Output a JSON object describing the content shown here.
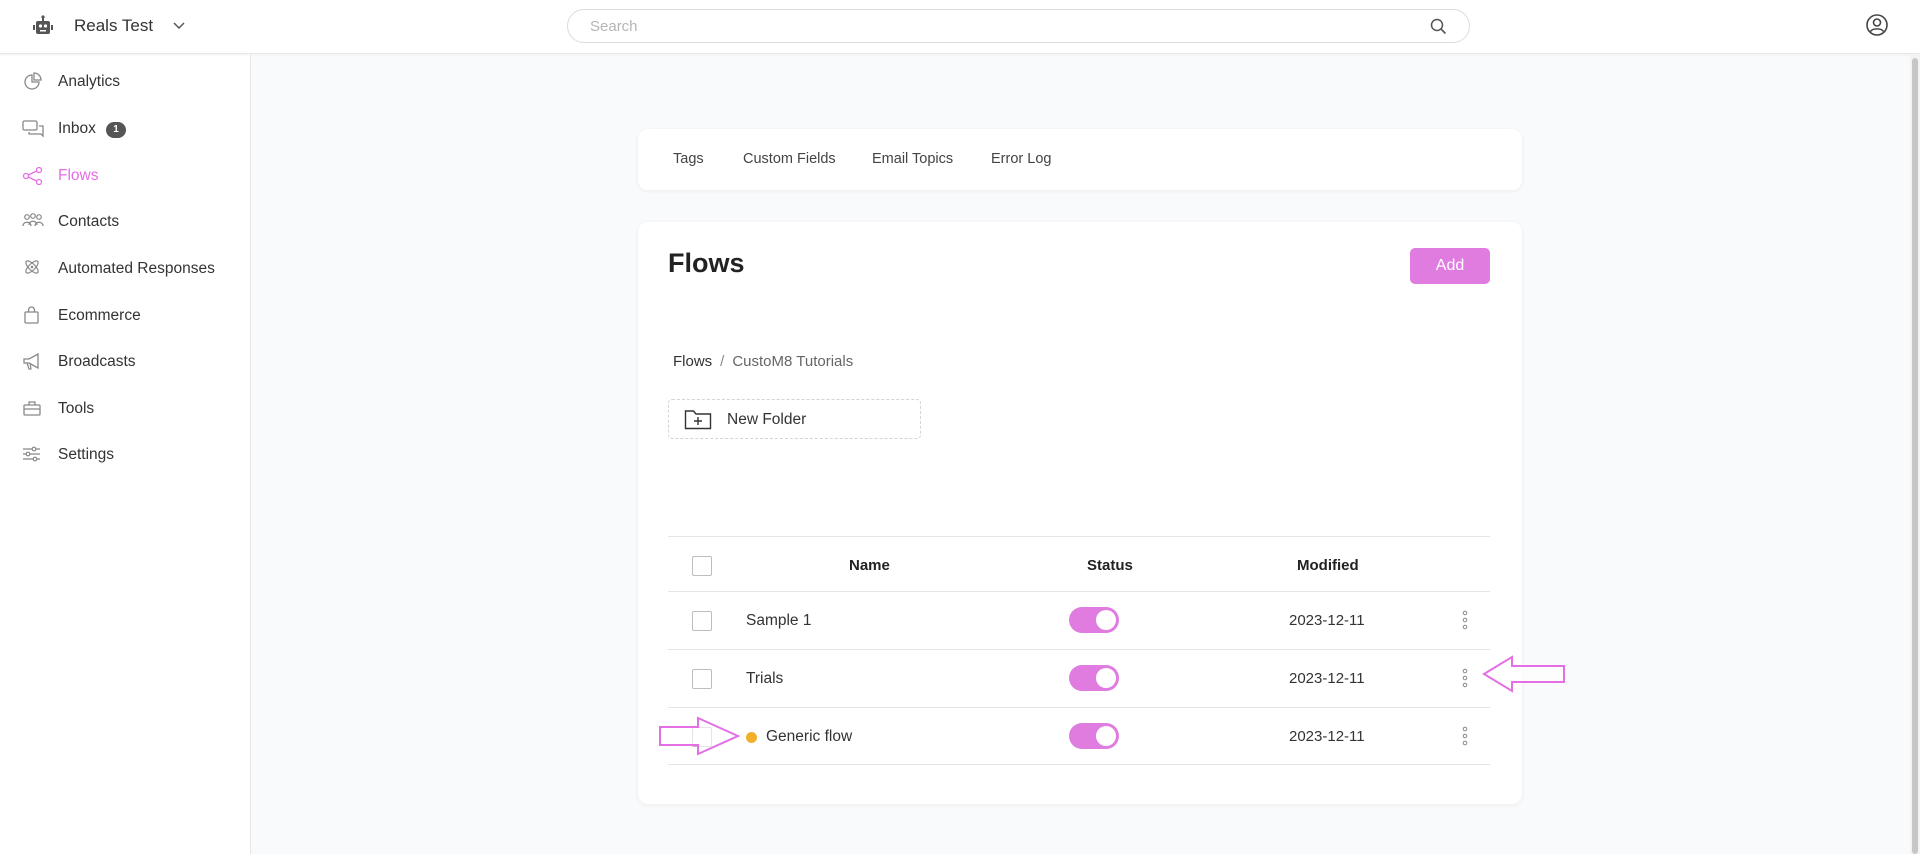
{
  "header": {
    "workspace_name": "Reals Test",
    "search_placeholder": "Search"
  },
  "sidebar": {
    "items": [
      {
        "label": "Analytics",
        "icon": "pie-chart-icon"
      },
      {
        "label": "Inbox",
        "icon": "chat-bubbles-icon",
        "badge": "1"
      },
      {
        "label": "Flows",
        "icon": "flows-icon",
        "active": true
      },
      {
        "label": "Contacts",
        "icon": "people-icon"
      },
      {
        "label": "Automated Responses",
        "icon": "atom-icon"
      },
      {
        "label": "Ecommerce",
        "icon": "shopping-bag-icon"
      },
      {
        "label": "Broadcasts",
        "icon": "megaphone-icon"
      },
      {
        "label": "Tools",
        "icon": "toolbox-icon"
      },
      {
        "label": "Settings",
        "icon": "sliders-icon"
      }
    ]
  },
  "tabs": [
    {
      "label": "Tags"
    },
    {
      "label": "Custom Fields"
    },
    {
      "label": "Email Topics"
    },
    {
      "label": "Error Log"
    }
  ],
  "main": {
    "title": "Flows",
    "add_label": "Add",
    "breadcrumb": {
      "root": "Flows",
      "separator": "/",
      "current": "CustoM8 Tutorials"
    },
    "new_folder_label": "New Folder"
  },
  "table": {
    "headers": {
      "name": "Name",
      "status": "Status",
      "modified": "Modified"
    },
    "rows": [
      {
        "name": "Sample 1",
        "status": "on",
        "modified": "2023-12-11",
        "indicator": false
      },
      {
        "name": "Trials",
        "status": "on",
        "modified": "2023-12-11",
        "indicator": false
      },
      {
        "name": "Generic flow",
        "status": "on",
        "modified": "2023-12-11",
        "indicator": true
      }
    ]
  },
  "colors": {
    "accent": "#e07be0",
    "active_nav": "#e46fe4",
    "indicator": "#f2b02a",
    "annotation_arrow": "#e46fe4"
  }
}
